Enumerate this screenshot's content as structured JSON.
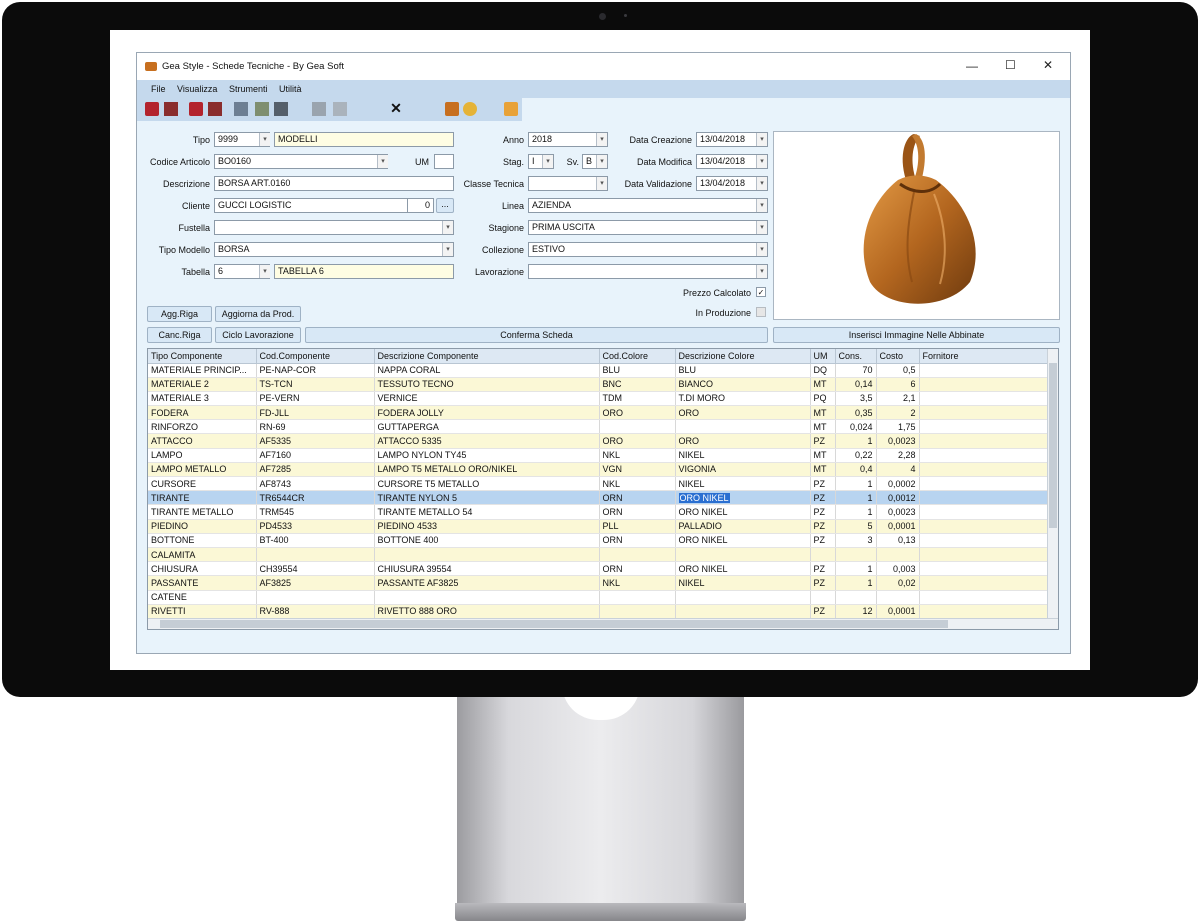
{
  "window": {
    "title": "Gea Style - Schede Tecniche - By Gea Soft"
  },
  "menu": [
    "File",
    "Visualizza",
    "Strumenti",
    "Utilità"
  ],
  "form": {
    "tipo": {
      "label": "Tipo",
      "code": "9999",
      "desc": "MODELLI"
    },
    "codice": {
      "label": "Codice Articolo",
      "value": "BO0160",
      "um_label": "UM",
      "um_value": ""
    },
    "descrizione": {
      "label": "Descrizione",
      "value": "BORSA ART.0160"
    },
    "cliente": {
      "label": "Cliente",
      "value": "GUCCI LOGISTIC",
      "num": "0",
      "btn": "..."
    },
    "fustella": {
      "label": "Fustella",
      "value": ""
    },
    "tipo_modello": {
      "label": "Tipo Modello",
      "value": "BORSA"
    },
    "tabella": {
      "label": "Tabella",
      "code": "6",
      "desc": "TABELLA 6"
    },
    "anno": {
      "label": "Anno",
      "value": "2018"
    },
    "stag": {
      "label": "Stag.",
      "value": "I",
      "sv_label": "Sv.",
      "sv_value": "B"
    },
    "classe": {
      "label": "Classe Tecnica",
      "value": ""
    },
    "linea": {
      "label": "Linea",
      "value": "AZIENDA"
    },
    "stagione": {
      "label": "Stagione",
      "value": "PRIMA USCITA"
    },
    "collezione": {
      "label": "Collezione",
      "value": "ESTIVO"
    },
    "lavorazione": {
      "label": "Lavorazione",
      "value": ""
    },
    "data_creazione": {
      "label": "Data Creazione",
      "value": "13/04/2018"
    },
    "data_modifica": {
      "label": "Data Modifica",
      "value": "13/04/2018"
    },
    "data_validazione": {
      "label": "Data Validazione",
      "value": "13/04/2018"
    },
    "prezzo_calcolato": {
      "label": "Prezzo Calcolato",
      "checked": true,
      "mark": "✓"
    },
    "in_produzione": {
      "label": "In Produzione",
      "checked": false
    }
  },
  "buttons": {
    "agg_riga": "Agg.Riga",
    "aggiorna_prod": "Aggiorna da Prod.",
    "canc_riga": "Canc.Riga",
    "ciclo": "Ciclo Lavorazione",
    "conferma": "Conferma Scheda",
    "inserisci": "Inserisci Immagine Nelle Abbinate"
  },
  "grid": {
    "headers": [
      "Tipo Componente",
      "Cod.Componente",
      "Descrizione Componente",
      "Cod.Colore",
      "Descrizione Colore",
      "UM",
      "Cons.",
      "Costo",
      "Fornitore"
    ],
    "rows": [
      [
        "MATERIALE PRINCIP...",
        "PE-NAP-COR",
        "NAPPA CORAL",
        "BLU",
        "BLU",
        "DQ",
        "70",
        "0,5",
        ""
      ],
      [
        "MATERIALE 2",
        "TS-TCN",
        "TESSUTO TECNO",
        "BNC",
        "BIANCO",
        "MT",
        "0,14",
        "6",
        ""
      ],
      [
        "MATERIALE 3",
        "PE-VERN",
        "VERNICE",
        "TDM",
        "T.DI MORO",
        "PQ",
        "3,5",
        "2,1",
        ""
      ],
      [
        "FODERA",
        "FD-JLL",
        "FODERA JOLLY",
        "ORO",
        "ORO",
        "MT",
        "0,35",
        "2",
        ""
      ],
      [
        "RINFORZO",
        "RN-69",
        "GUTTAPERGA",
        "",
        "",
        "MT",
        "0,024",
        "1,75",
        ""
      ],
      [
        "ATTACCO",
        "AF5335",
        "ATTACCO 5335",
        "ORO",
        "ORO",
        "PZ",
        "1",
        "0,0023",
        ""
      ],
      [
        "LAMPO",
        "AF7160",
        "LAMPO NYLON TY45",
        "NKL",
        "NIKEL",
        "MT",
        "0,22",
        "2,28",
        ""
      ],
      [
        "LAMPO METALLO",
        "AF7285",
        "LAMPO T5 METALLO ORO/NIKEL",
        "VGN",
        "VIGONIA",
        "MT",
        "0,4",
        "4",
        ""
      ],
      [
        "CURSORE",
        "AF8743",
        "CURSORE T5 METALLO",
        "NKL",
        "NIKEL",
        "PZ",
        "1",
        "0,0002",
        ""
      ],
      [
        "TIRANTE",
        "TR6544CR",
        "TIRANTE NYLON 5",
        "ORN",
        "ORO NIKEL",
        "PZ",
        "1",
        "0,0012",
        ""
      ],
      [
        "TIRANTE METALLO",
        "TRM545",
        "TIRANTE METALLO 54",
        "ORN",
        "ORO NIKEL",
        "PZ",
        "1",
        "0,0023",
        ""
      ],
      [
        "PIEDINO",
        "PD4533",
        "PIEDINO 4533",
        "PLL",
        "PALLADIO",
        "PZ",
        "5",
        "0,0001",
        ""
      ],
      [
        "BOTTONE",
        "BT-400",
        "BOTTONE 400",
        "ORN",
        "ORO NIKEL",
        "PZ",
        "3",
        "0,13",
        ""
      ],
      [
        "CALAMITA",
        "",
        "",
        "",
        "",
        "",
        "",
        "",
        ""
      ],
      [
        "CHIUSURA",
        "CH39554",
        "CHIUSURA 39554",
        "ORN",
        "ORO NIKEL",
        "PZ",
        "1",
        "0,003",
        ""
      ],
      [
        "PASSANTE",
        "AF3825",
        "PASSANTE AF3825",
        "NKL",
        "NIKEL",
        "PZ",
        "1",
        "0,02",
        ""
      ],
      [
        "CATENE",
        "",
        "",
        "",
        "",
        "",
        "",
        "",
        ""
      ],
      [
        "RIVETTI",
        "RV-888",
        "RIVETTO 888 ORO",
        "",
        "",
        "PZ",
        "12",
        "0,0001",
        ""
      ]
    ],
    "selected_row": 9
  }
}
